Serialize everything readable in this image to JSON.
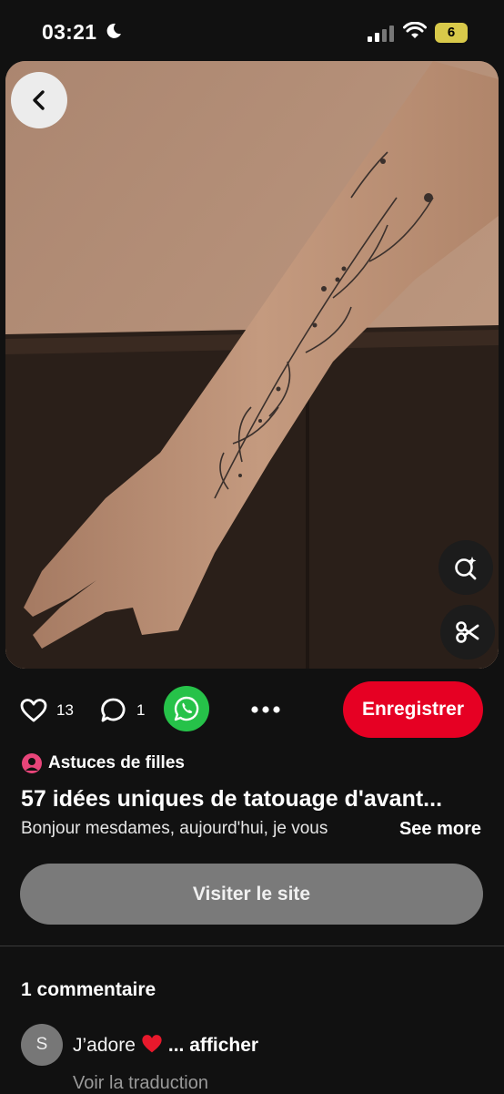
{
  "status": {
    "time": "03:21",
    "battery": "6"
  },
  "pin": {
    "likes": "13",
    "comments_count": "1",
    "save_label": "Enregistrer",
    "creator": "Astuces de filles",
    "title": "57 idées uniques de tatouage d'avant...",
    "description": "Bonjour mesdames, aujourd'hui, je vous",
    "see_more": "See more",
    "visit_label": "Visiter le site"
  },
  "comments": {
    "heading": "1 commentaire",
    "items": [
      {
        "avatar_letter": "S",
        "text": "J’adore",
        "emoji": "heart",
        "more": "... afficher",
        "translate": "Voir la traduction"
      }
    ]
  },
  "colors": {
    "save": "#e60023",
    "whatsapp": "#26c249",
    "visit": "#7a7a7a",
    "creator_icon": "#e8457a"
  },
  "icons": [
    "moon-icon",
    "signal-icon",
    "wifi-icon",
    "battery-icon",
    "back-arrow-icon",
    "visual-search-icon",
    "scissors-icon",
    "heart-icon",
    "comment-bubble-icon",
    "whatsapp-icon",
    "more-dots-icon",
    "creator-logo-icon",
    "red-heart-emoji"
  ]
}
